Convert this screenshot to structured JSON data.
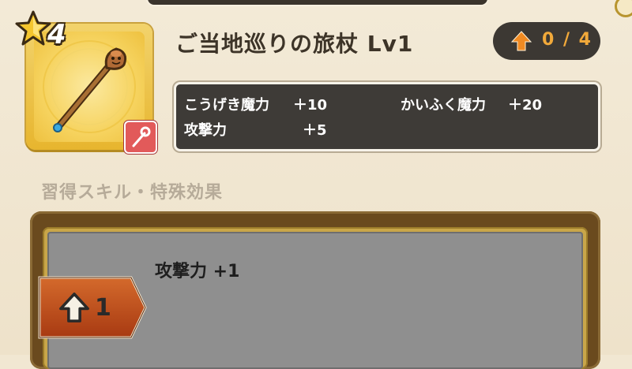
{
  "item": {
    "rarity": "4",
    "name": "ご当地巡りの旅杖 Lv1",
    "upgrade_count": "0 / 4",
    "stats": {
      "attack_magic_label": "こうげき魔力",
      "attack_magic_value": "＋10",
      "heal_magic_label": "かいふく魔力",
      "heal_magic_value": "＋20",
      "attack_label": "攻撃力",
      "attack_value": "＋5"
    }
  },
  "skills": {
    "heading": "習得スキル・特殊効果",
    "entries": [
      {
        "level": "1",
        "effect": "攻撃力 +1"
      }
    ]
  },
  "colors": {
    "upgrade_accent": "#f1a93a",
    "icon_frame": "#e7b52e",
    "weapon_type_badge": "#e25a5a"
  },
  "icons": {
    "rarity": "star-icon",
    "item": "staff-icon",
    "weapon_type": "staff-type-icon",
    "upgrade": "up-arrow-icon",
    "skill_level": "up-arrow-icon"
  }
}
